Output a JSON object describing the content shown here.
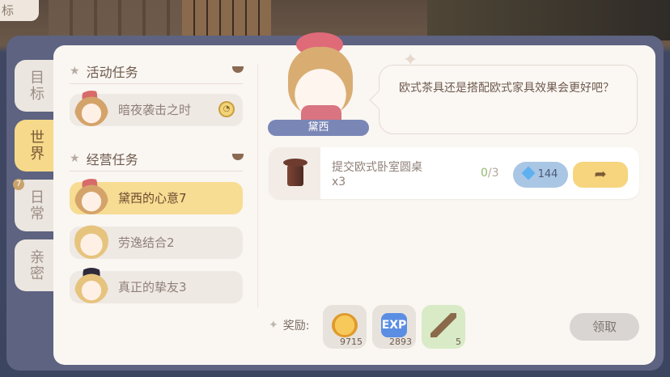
{
  "top_tab": {
    "label": "标"
  },
  "side_tabs": [
    {
      "label": "目标",
      "active": false
    },
    {
      "label": "世界",
      "active": true
    },
    {
      "label": "日常",
      "active": false,
      "badge": "7"
    },
    {
      "label": "亲密",
      "active": false
    }
  ],
  "sections": {
    "activity": {
      "title": "活动任务"
    },
    "business": {
      "title": "经营任务"
    }
  },
  "tasks": {
    "activity": [
      {
        "name": "暗夜袭击之时",
        "has_clock": true
      }
    ],
    "business": [
      {
        "name": "黛西的心意7",
        "active": true
      },
      {
        "name": "劳逸结合2",
        "active": false
      },
      {
        "name": "真正的挚友3",
        "active": false
      }
    ]
  },
  "character": {
    "name": "黛西"
  },
  "dialog": {
    "text": "欧式茶具还是搭配欧式家具效果会更好吧？"
  },
  "submit": {
    "item_name": "提交欧式卧室圆桌",
    "item_qty": "x3",
    "progress_current": "0",
    "progress_total": "/3",
    "gem_cost": "144",
    "go_icon": "arrow-right-icon"
  },
  "rewards": {
    "label": "奖励:",
    "items": [
      {
        "icon": "coin-icon",
        "amount": "9715"
      },
      {
        "icon": "exp-icon",
        "text": "EXP",
        "amount": "2893"
      },
      {
        "icon": "wood-log-icon",
        "amount": "5"
      }
    ]
  },
  "claim_button": "领取",
  "colors": {
    "accent_yellow": "#f6d57e",
    "gem_button": "#a9c6e4",
    "panel": "#faf6f2",
    "frame": "#5d6380"
  }
}
